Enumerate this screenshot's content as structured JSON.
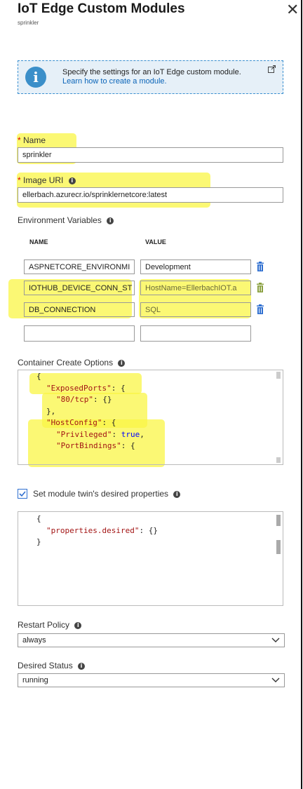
{
  "header": {
    "title": "IoT Edge Custom Modules",
    "subtitle": "sprinkler"
  },
  "info": {
    "text": "Specify the settings for an IoT Edge custom module.",
    "link": "Learn how to create a module."
  },
  "name_field": {
    "label": "Name",
    "required_mark": "*",
    "value": "sprinkler"
  },
  "image_field": {
    "label": "Image URI",
    "required_mark": "*",
    "value": "ellerbach.azurecr.io/sprinklernetcore:latest"
  },
  "env": {
    "label": "Environment Variables",
    "col_name": "NAME",
    "col_value": "VALUE",
    "rows": [
      {
        "name": "ASPNETCORE_ENVIRONMI",
        "value": "Development"
      },
      {
        "name": "IOTHUB_DEVICE_CONN_ST",
        "value": "HostName=EllerbachIOT.a"
      },
      {
        "name": "DB_CONNECTION",
        "value": "SQL"
      },
      {
        "name": "",
        "value": ""
      }
    ]
  },
  "container_options": {
    "label": "Container Create Options",
    "lines": [
      {
        "punct_pre": "{",
        "key": "",
        "punct_mid": "",
        "val": "",
        "punct_post": ""
      },
      {
        "punct_pre": "",
        "key": "\"ExposedPorts\"",
        "punct_mid": ": {",
        "val": "",
        "punct_post": ""
      },
      {
        "punct_pre": "",
        "key": "\"80/tcp\"",
        "punct_mid": ": {}",
        "val": "",
        "punct_post": ""
      },
      {
        "punct_pre": "},",
        "key": "",
        "punct_mid": "",
        "val": "",
        "punct_post": ""
      },
      {
        "punct_pre": "",
        "key": "\"HostConfig\"",
        "punct_mid": ": {",
        "val": "",
        "punct_post": ""
      },
      {
        "punct_pre": "",
        "key": "\"Privileged\"",
        "punct_mid": ": ",
        "val": "true",
        "punct_post": ","
      },
      {
        "punct_pre": "",
        "key": "\"PortBindings\"",
        "punct_mid": ": {",
        "val": "",
        "punct_post": ""
      }
    ]
  },
  "twin": {
    "checkbox_label": "Set module twin's desired properties",
    "checked": true,
    "lines": [
      {
        "punct_pre": "{",
        "key": "",
        "punct_mid": ""
      },
      {
        "punct_pre": "",
        "key": "\"properties.desired\"",
        "punct_mid": ": {}"
      },
      {
        "punct_pre": "}",
        "key": "",
        "punct_mid": ""
      }
    ]
  },
  "restart_policy": {
    "label": "Restart Policy",
    "value": "always"
  },
  "desired_status": {
    "label": "Desired Status",
    "value": "running"
  },
  "colors": {
    "accent": "#0a64b8",
    "highlight": "#f7f24a",
    "json_key": "#a31515",
    "json_value": "#0000ff"
  },
  "icons": {
    "info": "info-icon",
    "external": "external-link-icon",
    "delete": "trash-icon",
    "tooltip": "info-tooltip-icon",
    "close": "close-icon"
  }
}
